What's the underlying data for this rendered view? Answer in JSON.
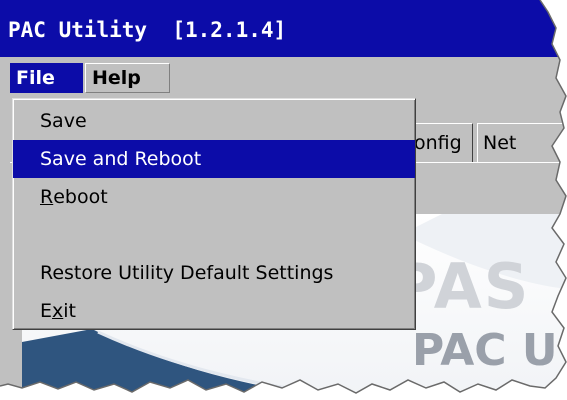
{
  "window": {
    "title": "PAC Utility  [1.2.1.4]"
  },
  "menubar": {
    "file_label": "File",
    "help_label": "Help"
  },
  "tabs": {
    "config_label": "onfig",
    "network_label": "Net"
  },
  "file_menu": {
    "items": [
      {
        "label": "Save"
      },
      {
        "label": "Save and Reboot",
        "highlighted": true
      },
      {
        "label_prefix": "",
        "label_underlined": "R",
        "label_rest": "eboot"
      },
      {
        "label": "Restore Utility Default Settings"
      },
      {
        "label_prefix": "E",
        "label_underlined": "x",
        "label_rest": "it"
      }
    ]
  },
  "background": {
    "logo_ghost": "PAS",
    "app_name": "PAC U"
  },
  "colors": {
    "title_bar": "#0c0ca8",
    "menu_bg": "#c0c0c0",
    "highlight": "#0c0ca8",
    "text_light": "#ffffff"
  }
}
